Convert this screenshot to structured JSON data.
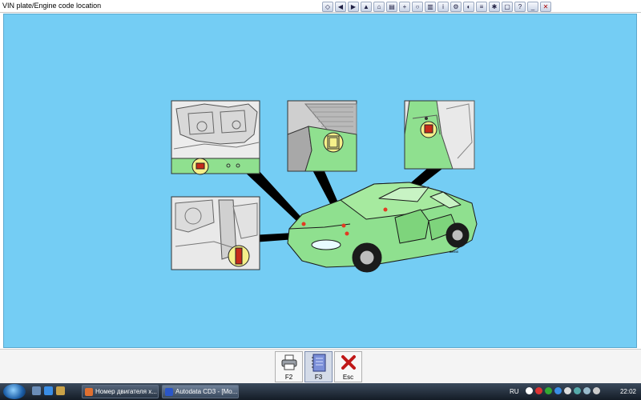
{
  "window": {
    "title": "VIN plate/Engine code location"
  },
  "toolbar_icons": [
    "nav-icon",
    "back-icon",
    "forward-icon",
    "up-icon",
    "home-icon",
    "print-icon",
    "zoom-icon",
    "search-icon",
    "book-icon",
    "info-icon",
    "wrench-icon",
    "gauge-icon",
    "list-icon",
    "settings-icon",
    "window-icon",
    "help-icon",
    "minimize-icon",
    "close-icon"
  ],
  "diagram": {
    "image_code": "88940"
  },
  "fkeys": [
    {
      "key": "F2",
      "icon": "printer-icon"
    },
    {
      "key": "F3",
      "icon": "notebook-icon"
    },
    {
      "key": "Esc",
      "icon": "close-x-icon"
    }
  ],
  "taskbar": {
    "tasks": [
      {
        "label": "Номер двигателя х..."
      },
      {
        "label": "Autodata CD3 - [Mo..."
      }
    ],
    "tray": {
      "lang": "RU",
      "clock": "22:02"
    }
  },
  "colors": {
    "background_blue": "#74cdf4",
    "car_green": "#8fe08f",
    "marker_yellow": "#f5f08a",
    "callout_line": "#000000"
  }
}
